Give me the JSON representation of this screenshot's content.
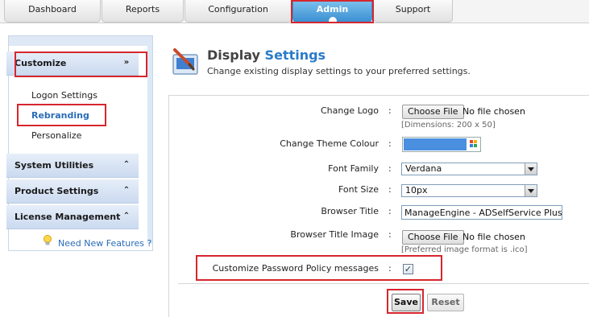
{
  "tabs": [
    {
      "label": "Dashboard"
    },
    {
      "label": "Reports"
    },
    {
      "label": "Configuration"
    },
    {
      "label": "Admin",
      "active": true
    },
    {
      "label": "Support"
    }
  ],
  "sidebar": {
    "customize_label": "Customize",
    "items": [
      {
        "label": "Logon Settings"
      },
      {
        "label": "Rebranding",
        "active": true
      },
      {
        "label": "Personalize"
      }
    ],
    "sections": [
      {
        "label": "System Utilities"
      },
      {
        "label": "Product Settings"
      },
      {
        "label": "License Management"
      }
    ],
    "new_features_label": "Need New Features ?"
  },
  "header": {
    "title_plain": "Display",
    "title_highlight": "Settings",
    "description": "Change existing display settings to your preferred settings."
  },
  "form": {
    "logo": {
      "label": "Change Logo",
      "button": "Choose File",
      "status": "No file chosen",
      "hint": "[Dimensions: 200 x 50]"
    },
    "theme_colour": {
      "label": "Change Theme Colour",
      "value": "#4a8fe0"
    },
    "font_family": {
      "label": "Font Family",
      "value": "Verdana"
    },
    "font_size": {
      "label": "Font Size",
      "value": "10px"
    },
    "browser_title": {
      "label": "Browser Title",
      "value": "ManageEngine - ADSelfService Plus"
    },
    "browser_title_image": {
      "label": "Browser Title Image",
      "button": "Choose File",
      "status": "No file chosen",
      "hint": "[Preferred image format is .ico]"
    },
    "password_policy": {
      "label": "Customize Password Policy messages",
      "checked": true
    }
  },
  "actions": {
    "save": "Save",
    "reset": "Reset"
  },
  "colors": {
    "accent": "#2b7bc9",
    "highlight_box": "#d6262e",
    "active_tab": "#3a8fd1"
  }
}
